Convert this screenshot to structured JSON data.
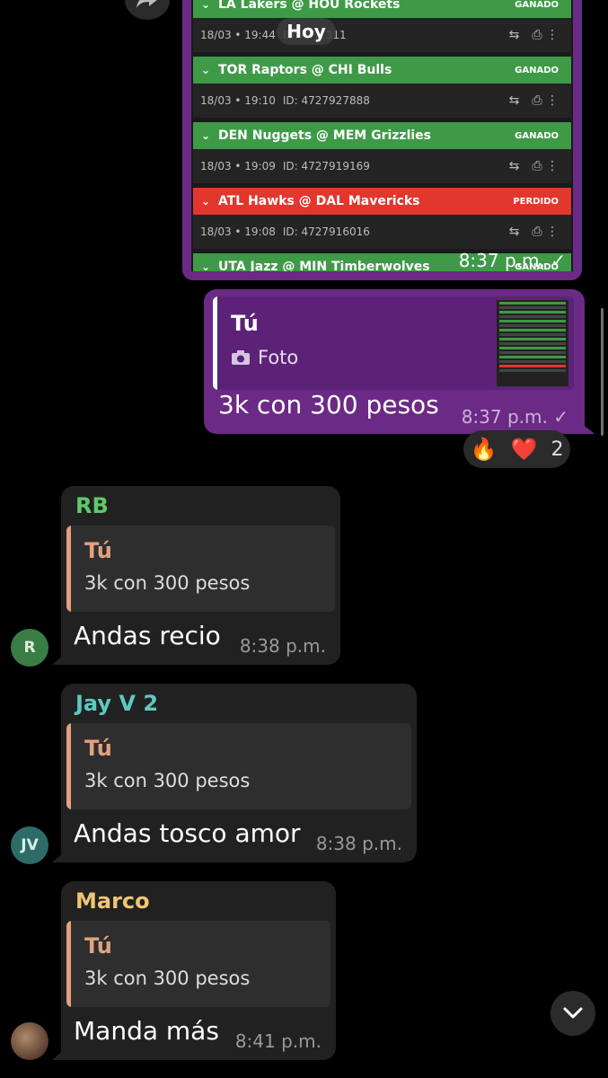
{
  "date_chip": "Hoy",
  "photo_message": {
    "time": "8:37 p.m.",
    "bets": [
      {
        "title": "LA Lakers @ HOU Rockets",
        "result": "GANADO",
        "status": "win",
        "datetime": "18/03 • 19:44",
        "id": "ID: 47…311"
      },
      {
        "title": "TOR Raptors @ CHI Bulls",
        "result": "GANADO",
        "status": "win",
        "datetime": "18/03 • 19:10",
        "id": "ID: 4727927888"
      },
      {
        "title": "DEN Nuggets @ MEM Grizzlies",
        "result": "GANADO",
        "status": "win",
        "datetime": "18/03 • 19:09",
        "id": "ID: 4727919169"
      },
      {
        "title": "ATL Hawks @ DAL Mavericks",
        "result": "PERDIDO",
        "status": "loss",
        "datetime": "18/03 • 19:08",
        "id": "ID: 4727916016"
      },
      {
        "title": "UTA Jazz @ MIN Timberwolves",
        "result": "GANADO",
        "status": "win",
        "datetime": "",
        "id": ""
      }
    ]
  },
  "outgoing_message": {
    "reply_name": "Tú",
    "reply_kind": "Foto",
    "text": "3k con 300 pesos",
    "time": "8:37 p.m.",
    "reactions": {
      "emoji1": "🔥",
      "emoji2": "❤️",
      "count": "2"
    }
  },
  "incoming_messages": [
    {
      "sender": "RB",
      "sender_color": "#5fc96b",
      "avatar_text": "R",
      "avatar_color": "#3a7d44",
      "quote_name": "Tú",
      "quote_text": "3k con 300 pesos",
      "text": "Andas recio",
      "time": "8:38 p.m."
    },
    {
      "sender": "Jay V 2",
      "sender_color": "#5fc9c0",
      "avatar_text": "JV",
      "avatar_color": "#2c6b68",
      "quote_name": "Tú",
      "quote_text": "3k con 300 pesos",
      "text": "Andas tosco amor",
      "time": "8:38 p.m."
    },
    {
      "sender": "Marco",
      "sender_color": "#f0c674",
      "avatar_text": "",
      "avatar_color": "#7a5a4a",
      "quote_name": "Tú",
      "quote_text": "3k con 300 pesos",
      "text": "Manda más",
      "time": "8:41 p.m."
    }
  ],
  "colors": {
    "outgoing_bubble": "#6b2a86",
    "incoming_bubble": "#212121",
    "win": "#3f9a47",
    "loss": "#e1372d"
  },
  "icons": [
    "forward-icon",
    "share-icon",
    "print-icon",
    "more-icon",
    "camera-icon",
    "check-icon",
    "chevron-down-icon"
  ]
}
